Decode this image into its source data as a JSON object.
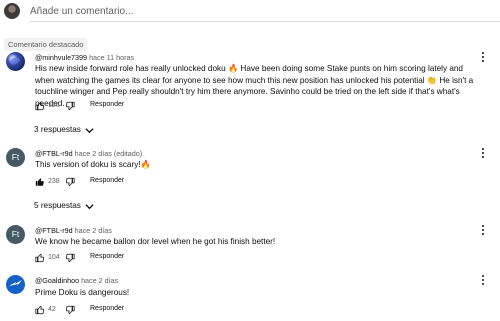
{
  "compose": {
    "placeholder": "Añade un comentario..."
  },
  "featured_label": "Comentario destacado",
  "comments": [
    {
      "user": "@minhvule7399",
      "time": "hace 11 horas",
      "text": "His new inside forward role has really unlocked doku 🔥 Have been doing some Stake punts on him scoring lately and when watching the games its clear for anyone to see how much this new position has unlocked his potential 👏 He isn't a touchline winger and Pep really shouldn't try him there anymore. Savinho could be tried on the left side if that's what's needed.",
      "likes": "126",
      "reply_label": "Responder",
      "replies": "3 respuestas"
    },
    {
      "user": "@FTBL-r9d",
      "avatar_text": "Ft",
      "time": "hace 2 días (editado)",
      "text": "This version of doku is scary!🔥",
      "likes": "238",
      "reply_label": "Responder",
      "replies": "5 respuestas"
    },
    {
      "user": "@FTBL-r9d",
      "avatar_text": "Ft",
      "time": "hace 2 días",
      "text": "We know he became ballon dor level when he got his finish better!",
      "likes": "104",
      "reply_label": "Responder"
    },
    {
      "user": "@Goaldinhoo",
      "time": "hace 2 días",
      "text": "Prime Doku is dangerous!",
      "likes": "42",
      "reply_label": "Responder"
    }
  ]
}
